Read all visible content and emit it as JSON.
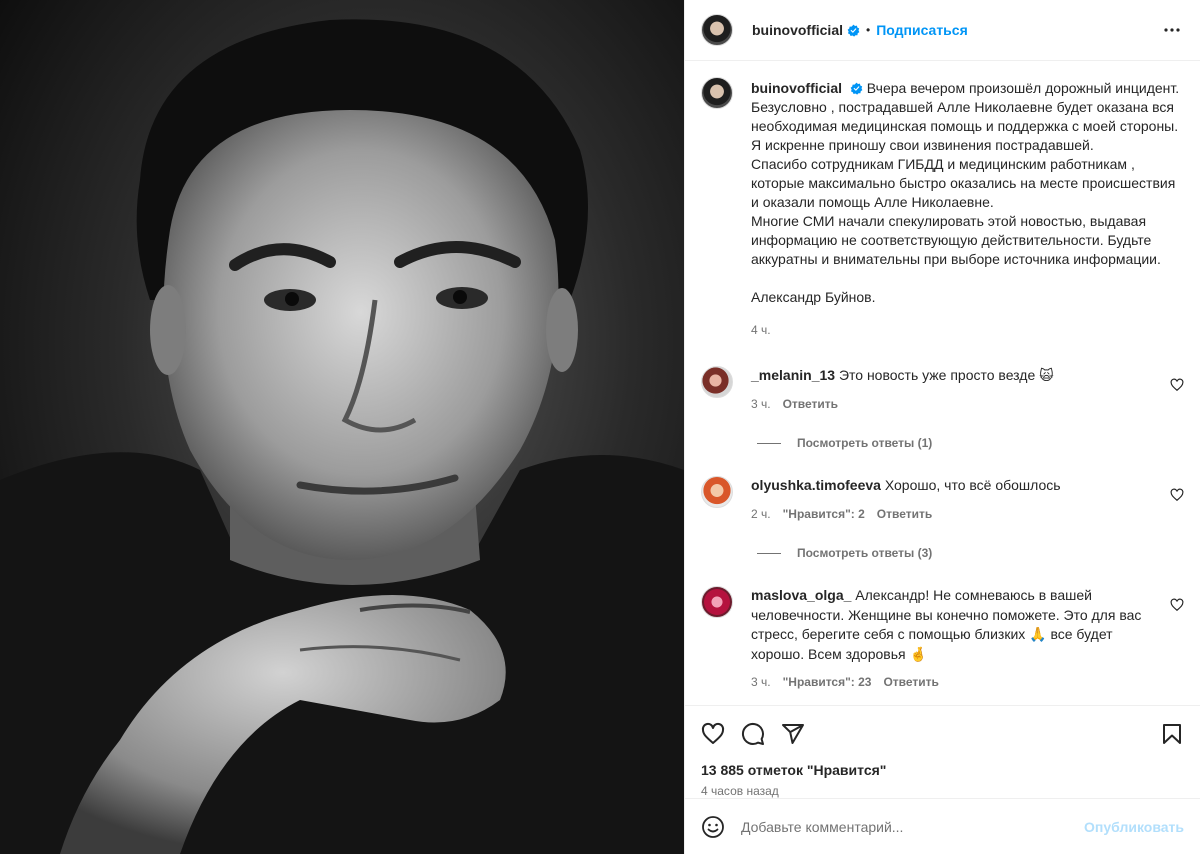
{
  "post": {
    "username": "buinovofficial",
    "dot": "•",
    "follow_label": "Подписаться",
    "caption": {
      "username": "buinovofficial",
      "text_lead": "Вчера вечером произошёл дорожный инцидент.",
      "paragraphs": "Безусловно , пострадавшей Алле Николаевне будет оказана вся необходимая медицинская помощь и поддержка с моей стороны. Я искренне приношу свои извинения пострадавшей.\nСпасибо сотрудникам ГИБДД и медицинским работникам , которые максимально быстро оказались на месте происшествия и оказали помощь Алле Николаевне.\nМногие СМИ начали спекулировать этой новостью, выдавая информацию не соответствующую действительности. Будьте аккуратны и внимательны при выборе источника информации.",
      "signature": "Александр Буйнов.",
      "time": "4 ч."
    },
    "comments": [
      {
        "username": "_melanin_13",
        "text": "Это новость уже просто везде 🙀",
        "time": "3 ч.",
        "likes": "",
        "reply_label": "Ответить",
        "replies_label": "Посмотреть ответы (1)"
      },
      {
        "username": "olyushka.timofeeva",
        "text": "Хорошо, что всё обошлось",
        "time": "2 ч.",
        "likes": "\"Нравится\": 2",
        "reply_label": "Ответить",
        "replies_label": "Посмотреть ответы (3)"
      },
      {
        "username": "maslova_olga_",
        "text": "Александр! Не сомневаюсь в вашей человечности. Женщине вы конечно поможете. Это для вас стресс, берегите себя с помощью близких 🙏 все будет хорошо. Всем здоровья 🤞",
        "time": "3 ч.",
        "likes": "\"Нравится\": 23",
        "reply_label": "Ответить",
        "replies_label": ""
      }
    ],
    "likes_count": "13 885 отметок \"Нравится\"",
    "posted_ago": "4 часов назад",
    "comment_placeholder": "Добавьте комментарий...",
    "publish_label": "Опубликовать"
  },
  "colors": {
    "accent": "#0095f6",
    "publish_disabled": "#b2dffc",
    "muted": "#737373",
    "text": "#262626"
  },
  "icons": [
    "more-icon",
    "verified-icon",
    "heart-icon",
    "comment-icon",
    "share-icon",
    "bookmark-icon",
    "emoji-icon"
  ]
}
